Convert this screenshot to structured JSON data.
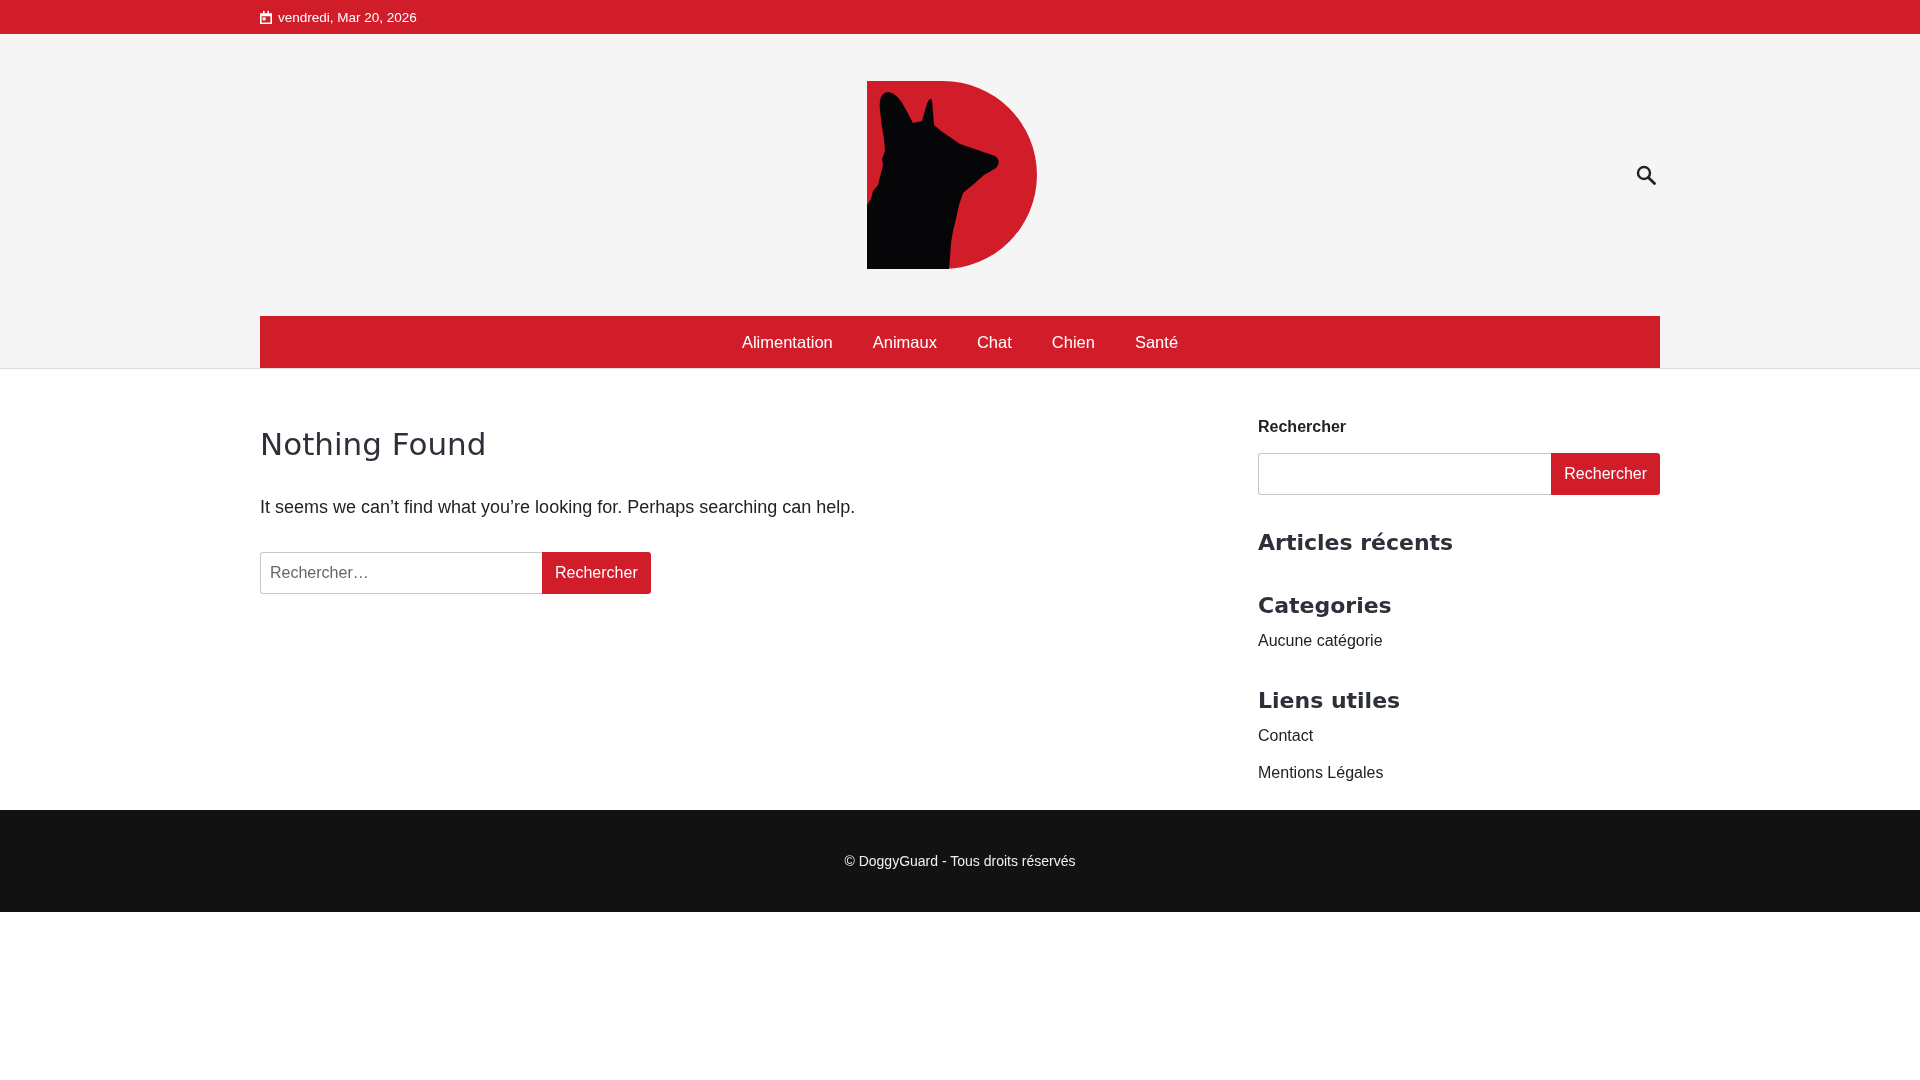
{
  "top_bar": {
    "date": "vendredi, Mar 20, 2026"
  },
  "nav": {
    "items": [
      {
        "label": "Alimentation",
        "selected": false
      },
      {
        "label": "Animaux",
        "selected": false
      },
      {
        "label": "Chat",
        "selected": false
      },
      {
        "label": "Chien",
        "selected": false
      },
      {
        "label": "Santé",
        "selected": false
      }
    ]
  },
  "main": {
    "title": "Nothing Found",
    "message": "It seems we can’t find what you’re looking for. Perhaps searching can help.",
    "search": {
      "placeholder": "Rechercher…",
      "button": "Rechercher"
    }
  },
  "sidebar": {
    "search": {
      "label": "Rechercher",
      "button": "Rechercher"
    },
    "widgets": [
      {
        "title": "Articles récents"
      },
      {
        "title": "Categories",
        "items": [
          "Aucune catégorie"
        ]
      },
      {
        "title": "Liens utiles",
        "items": [
          "Contact",
          "Mentions Légales"
        ]
      }
    ]
  },
  "footer": {
    "text": "© DoggyGuard - Tous droits réservés"
  }
}
